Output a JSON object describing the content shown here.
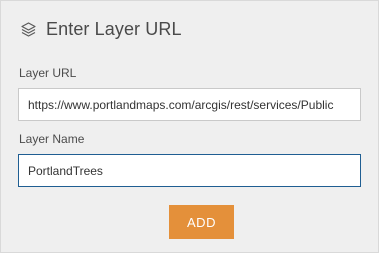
{
  "header": {
    "title": "Enter Layer URL",
    "icon": "layers-icon"
  },
  "layer_url": {
    "label": "Layer URL",
    "value": "https://www.portlandmaps.com/arcgis/rest/services/Public"
  },
  "layer_name": {
    "label": "Layer Name",
    "value": "PortlandTrees"
  },
  "add_button": {
    "label": "ADD",
    "color": "#e4903a"
  },
  "colors": {
    "panel_bg": "#efefef",
    "focus_border": "#1f5e92"
  }
}
